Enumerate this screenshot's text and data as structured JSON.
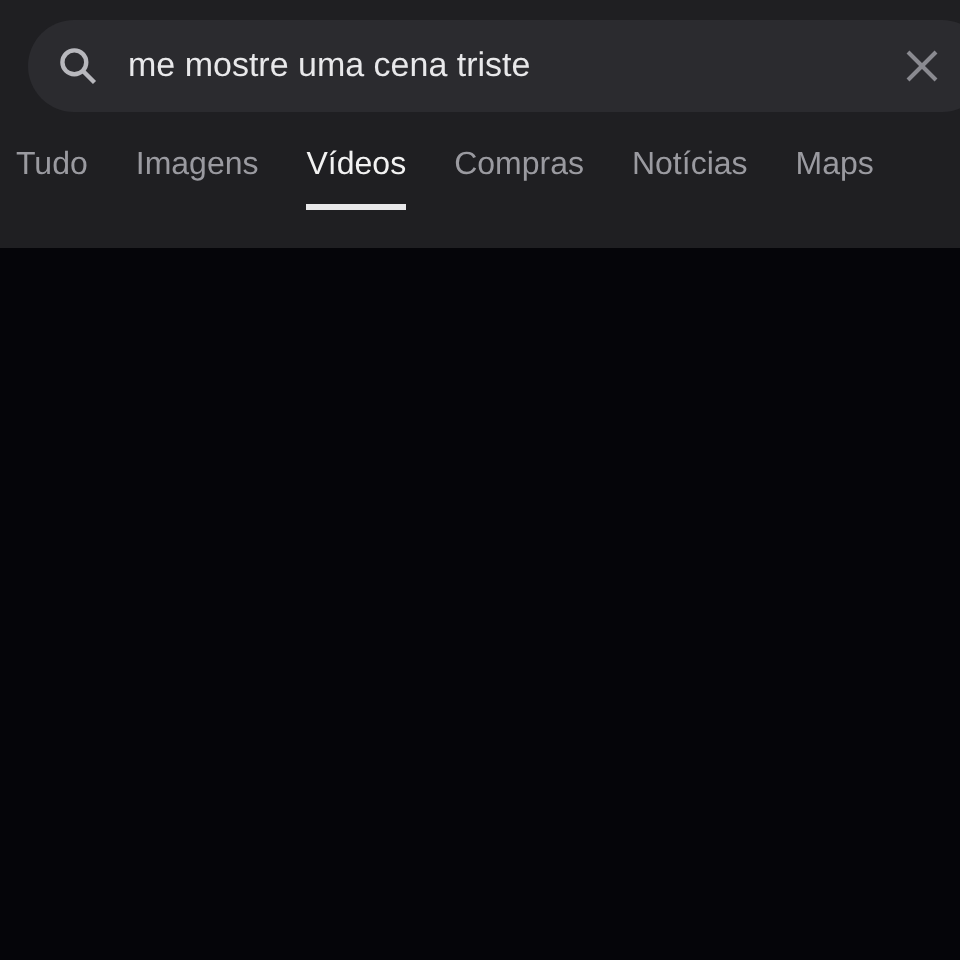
{
  "search": {
    "value": "me mostre uma cena triste"
  },
  "tabs": [
    {
      "label": "Tudo",
      "selected": false
    },
    {
      "label": "Imagens",
      "selected": false
    },
    {
      "label": "Vídeos",
      "selected": true
    },
    {
      "label": "Compras",
      "selected": false
    },
    {
      "label": "Notícias",
      "selected": false
    },
    {
      "label": "Maps",
      "selected": false
    }
  ]
}
